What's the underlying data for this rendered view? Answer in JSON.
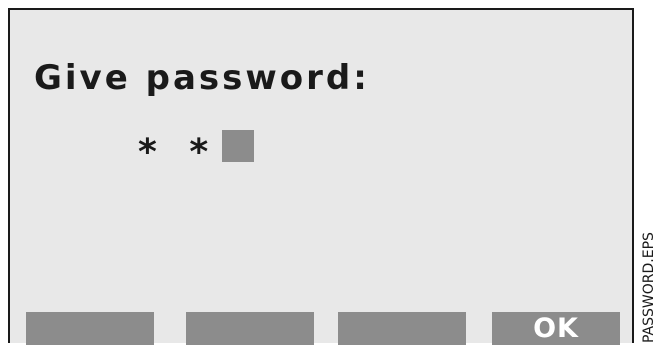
{
  "dialog": {
    "title": "Give password:",
    "masked_input": "* *"
  },
  "softkeys": {
    "key1_label": "",
    "key2_label": "",
    "key3_label": "",
    "ok_label": "OK"
  },
  "side_label": "PASSWORD.EPS",
  "colors": {
    "screen_bg": "#e8e8e8",
    "key_fill": "#8c8c8c",
    "text": "#1a1a1a"
  }
}
